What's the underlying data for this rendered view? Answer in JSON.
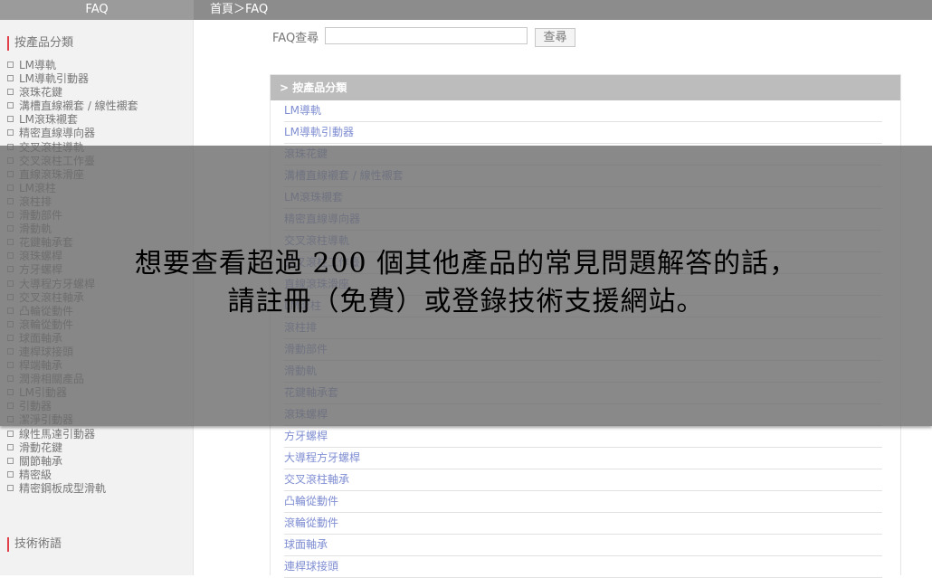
{
  "header": {
    "side_title": "FAQ",
    "breadcrumb": "首頁＞FAQ"
  },
  "sidebar": {
    "section_products": "按產品分類",
    "items": [
      "LM導軌",
      "LM導軌引動器",
      "滾珠花鍵",
      "溝槽直線襯套 / 線性襯套",
      "LM滾珠襯套",
      "精密直線導向器",
      "交叉滾柱導軌",
      "交叉滾柱工作臺",
      "直線滾珠滑座",
      "LM滾柱",
      "滾柱排",
      "滑動部件",
      "滑動軌",
      "花鍵軸承套",
      "滾珠螺桿",
      "方牙螺桿",
      "大導程方牙螺桿",
      "交叉滾柱軸承",
      "凸輪從動件",
      "滾輪從動件",
      "球面軸承",
      "連桿球接頭",
      "桿端軸承",
      "潤滑相關產品",
      "LM引動器",
      "引動器",
      "潔淨引動器",
      "線性馬達引動器",
      "滑動花鍵",
      "關節軸承",
      "精密級",
      "精密鋼板成型滑軌"
    ],
    "section_terms": "技術術語"
  },
  "search": {
    "label": "FAQ查尋",
    "value": "",
    "button": "查尋"
  },
  "panel": {
    "title": "> 按產品分類",
    "items": [
      "LM導軌",
      "LM導軌引動器",
      "滾珠花鍵",
      "溝槽直線襯套 / 線性襯套",
      "LM滾珠襯套",
      "精密直線導向器",
      "交叉滾柱導軌",
      "交叉滾柱工作臺",
      "直線滾珠滑座",
      "LM滾柱",
      "滾柱排",
      "滑動部件",
      "滑動軌",
      "花鍵軸承套",
      "滾珠螺桿",
      "方牙螺桿",
      "大導程方牙螺桿",
      "交叉滾柱軸承",
      "凸輪從動件",
      "滾輪從動件",
      "球面軸承",
      "連桿球接頭"
    ]
  },
  "overlay": {
    "line1": "想要查看超過 200 個其他產品的常見問題解答的話，",
    "line2": "請註冊（免費）或登錄技術支援網站。"
  }
}
